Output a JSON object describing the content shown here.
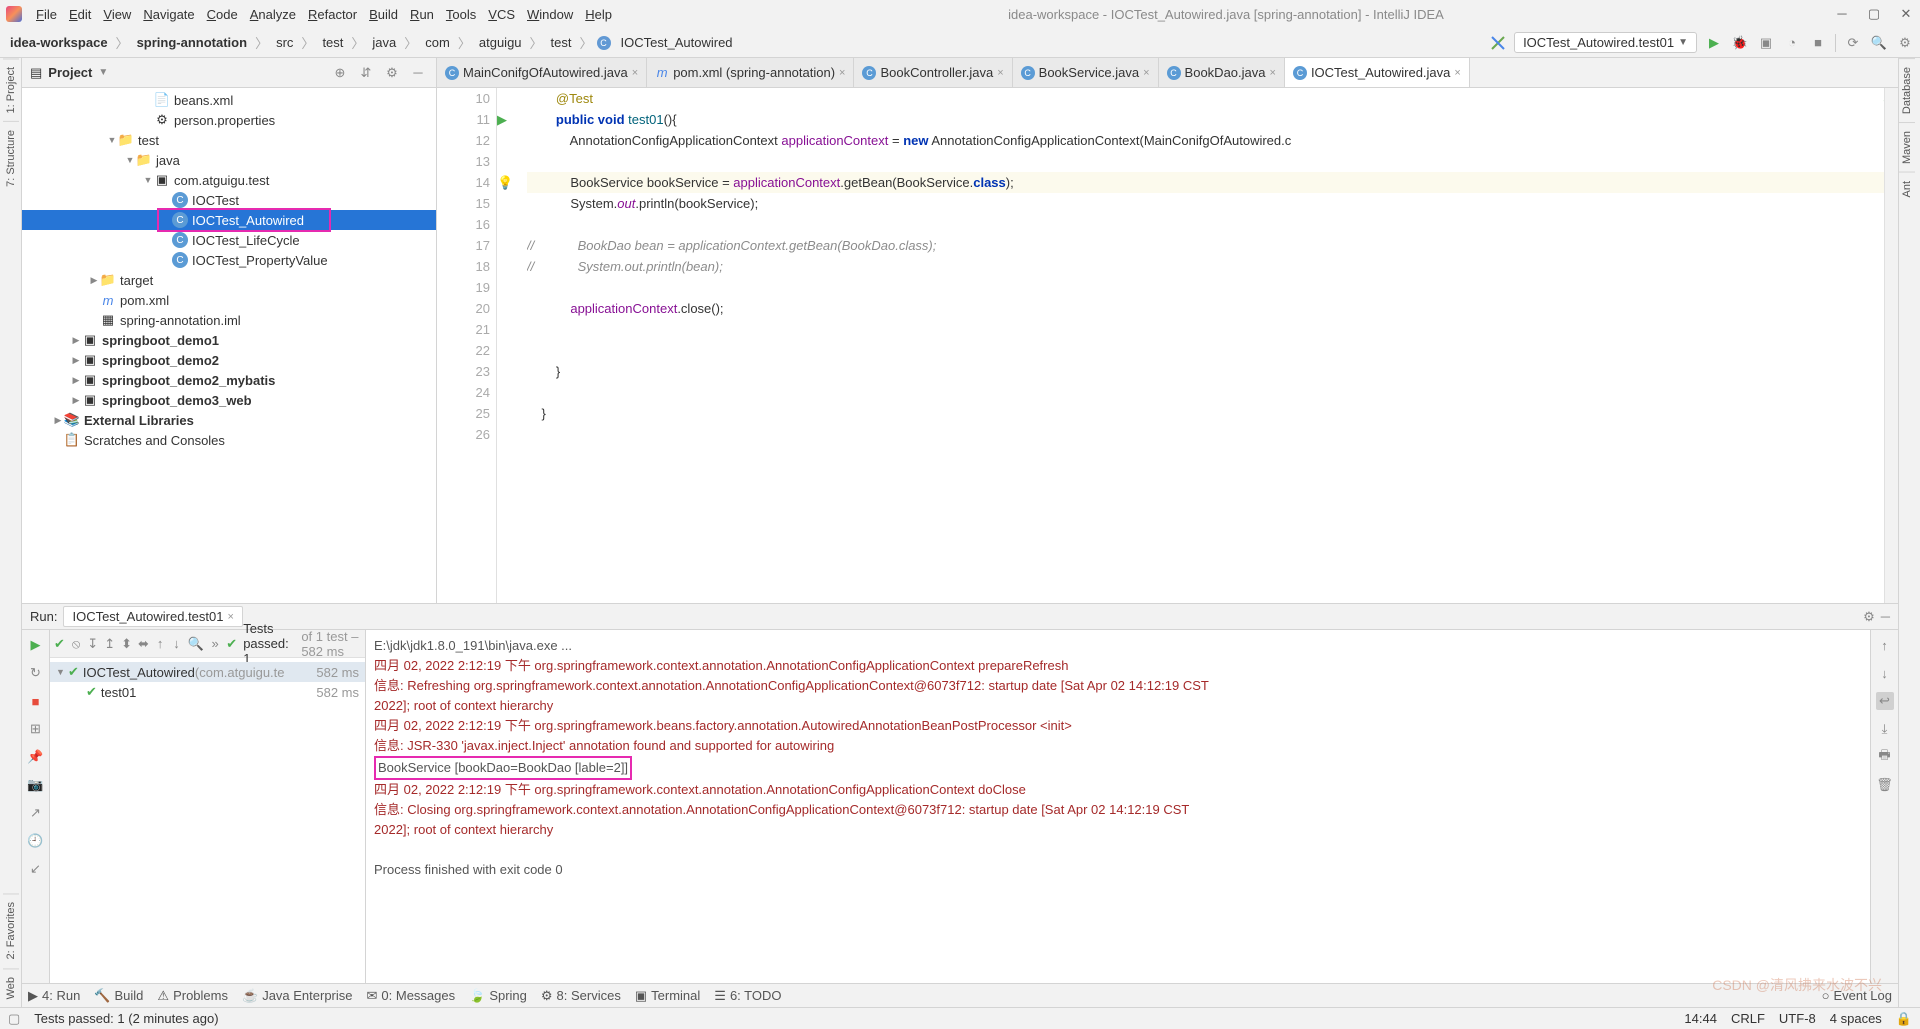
{
  "window": {
    "title": "idea-workspace - IOCTest_Autowired.java [spring-annotation] - IntelliJ IDEA"
  },
  "menu": [
    "File",
    "Edit",
    "View",
    "Navigate",
    "Code",
    "Analyze",
    "Refactor",
    "Build",
    "Run",
    "Tools",
    "VCS",
    "Window",
    "Help"
  ],
  "breadcrumb": [
    "idea-workspace",
    "spring-annotation",
    "src",
    "test",
    "java",
    "com",
    "atguigu",
    "test",
    "IOCTest_Autowired"
  ],
  "runConfig": "IOCTest_Autowired.test01",
  "leftTabs": [
    "1: Project",
    "7: Structure",
    "2: Favorites",
    "Web"
  ],
  "rightTabs": [
    "Database",
    "Maven",
    "Ant"
  ],
  "projectPanel": {
    "title": "Project",
    "tree": [
      {
        "depth": 5,
        "icon": "xml",
        "label": "beans.xml"
      },
      {
        "depth": 5,
        "icon": "prop",
        "label": "person.properties"
      },
      {
        "depth": 3,
        "exp": "▼",
        "icon": "folder",
        "label": "test"
      },
      {
        "depth": 4,
        "exp": "▼",
        "icon": "folder",
        "label": "java"
      },
      {
        "depth": 5,
        "exp": "▼",
        "icon": "pkg",
        "label": "com.atguigu.test"
      },
      {
        "depth": 6,
        "icon": "cls",
        "label": "IOCTest"
      },
      {
        "depth": 6,
        "icon": "cls",
        "label": "IOCTest_Autowired",
        "selected": true,
        "redbox": true
      },
      {
        "depth": 6,
        "icon": "cls",
        "label": "IOCTest_LifeCycle"
      },
      {
        "depth": 6,
        "icon": "cls",
        "label": "IOCTest_PropertyValue"
      },
      {
        "depth": 2,
        "exp": "▶",
        "icon": "folder-y",
        "label": "target"
      },
      {
        "depth": 2,
        "icon": "mvn",
        "label": "pom.xml"
      },
      {
        "depth": 2,
        "icon": "iml",
        "label": "spring-annotation.iml"
      },
      {
        "depth": 1,
        "exp": "▶",
        "icon": "mod",
        "label": "springboot_demo1"
      },
      {
        "depth": 1,
        "exp": "▶",
        "icon": "mod",
        "label": "springboot_demo2"
      },
      {
        "depth": 1,
        "exp": "▶",
        "icon": "mod",
        "label": "springboot_demo2_mybatis"
      },
      {
        "depth": 1,
        "exp": "▶",
        "icon": "mod",
        "label": "springboot_demo3_web"
      },
      {
        "depth": 0,
        "exp": "▶",
        "icon": "lib",
        "label": "External Libraries"
      },
      {
        "depth": 0,
        "icon": "scratch",
        "label": "Scratches and Consoles"
      }
    ]
  },
  "tabs": [
    {
      "icon": "cls",
      "label": "MainConifgOfAutowired.java"
    },
    {
      "icon": "mvn",
      "label": "pom.xml (spring-annotation)"
    },
    {
      "icon": "cls",
      "label": "BookController.java"
    },
    {
      "icon": "cls",
      "label": "BookService.java"
    },
    {
      "icon": "cls",
      "label": "BookDao.java"
    },
    {
      "icon": "cls",
      "label": "IOCTest_Autowired.java",
      "active": true
    }
  ],
  "editor": {
    "startLine": 10,
    "lines": [
      {
        "n": 10,
        "html": "        <span class='ann'>@Test</span>"
      },
      {
        "n": 11,
        "marker": "run",
        "html": "        <span class='kw'>public void</span> <span class='mth'>test01</span>(){"
      },
      {
        "n": 12,
        "html": "            AnnotationConfigApplicationContext <span class='fld'>applicationContext</span> = <span class='kw'>new</span> AnnotationConfigApplicationContext(MainConifgOfAutowired.c"
      },
      {
        "n": 13,
        "html": ""
      },
      {
        "n": 14,
        "marker": "bulb",
        "caret": true,
        "html": "            BookService bookService = <span class='fld'>applicationContext</span>.getBean(BookService.<span class='kw'>class</span>);"
      },
      {
        "n": 15,
        "html": "            System.<span class='fld ital'>out</span>.println(bookService);"
      },
      {
        "n": 16,
        "html": ""
      },
      {
        "n": 17,
        "html": "<span class='cmt'>//            BookDao bean = applicationContext.getBean(BookDao.class);</span>"
      },
      {
        "n": 18,
        "html": "<span class='cmt'>//            System.out.println(bean);</span>"
      },
      {
        "n": 19,
        "html": ""
      },
      {
        "n": 20,
        "html": "            <span class='fld'>applicationContext</span>.close();"
      },
      {
        "n": 21,
        "html": ""
      },
      {
        "n": 22,
        "html": ""
      },
      {
        "n": 23,
        "html": "        }"
      },
      {
        "n": 24,
        "html": ""
      },
      {
        "n": 25,
        "html": "    }"
      },
      {
        "n": 26,
        "html": ""
      }
    ]
  },
  "run": {
    "title": "Run:",
    "subtab": "IOCTest_Autowired.test01",
    "testsPassed": "Tests passed: 1",
    "testsTotal": " of 1 test – 582 ms",
    "tree": [
      {
        "depth": 0,
        "exp": "▼",
        "label": "IOCTest_Autowired",
        "dim": " (com.atguigu.te",
        "ms": "582 ms",
        "selected": true
      },
      {
        "depth": 1,
        "label": "test01",
        "ms": "582 ms"
      }
    ],
    "console": [
      {
        "cls": "",
        "text": "E:\\jdk\\jdk1.8.0_191\\bin\\java.exe ..."
      },
      {
        "cls": "err",
        "text": "四月 02, 2022 2:12:19 下午 org.springframework.context.annotation.AnnotationConfigApplicationContext prepareRefresh"
      },
      {
        "cls": "err",
        "text": "信息: Refreshing org.springframework.context.annotation.AnnotationConfigApplicationContext@6073f712: startup date [Sat Apr 02 14:12:19 CST"
      },
      {
        "cls": "err",
        "text": " 2022]; root of context hierarchy"
      },
      {
        "cls": "err",
        "text": "四月 02, 2022 2:12:19 下午 org.springframework.beans.factory.annotation.AutowiredAnnotationBeanPostProcessor <init>"
      },
      {
        "cls": "err",
        "text": "信息: JSR-330 'javax.inject.Inject' annotation found and supported for autowiring"
      },
      {
        "cls": "",
        "text": "BookService [bookDao=BookDao [lable=2]]",
        "boxed": true
      },
      {
        "cls": "err",
        "text": "四月 02, 2022 2:12:19 下午 org.springframework.context.annotation.AnnotationConfigApplicationContext doClose"
      },
      {
        "cls": "err",
        "text": "信息: Closing org.springframework.context.annotation.AnnotationConfigApplicationContext@6073f712: startup date [Sat Apr 02 14:12:19 CST"
      },
      {
        "cls": "err",
        "text": " 2022]; root of context hierarchy"
      },
      {
        "cls": "",
        "text": ""
      },
      {
        "cls": "",
        "text": "Process finished with exit code 0"
      }
    ]
  },
  "toolstrip": [
    {
      "icon": "▶",
      "label": "4: Run"
    },
    {
      "icon": "🔨",
      "label": "Build"
    },
    {
      "icon": "⚠",
      "label": "Problems"
    },
    {
      "icon": "☕",
      "label": "Java Enterprise"
    },
    {
      "icon": "✉",
      "label": "0: Messages"
    },
    {
      "icon": "🍃",
      "label": "Spring"
    },
    {
      "icon": "⚙",
      "label": "8: Services"
    },
    {
      "icon": "▣",
      "label": "Terminal"
    },
    {
      "icon": "☰",
      "label": "6: TODO"
    }
  ],
  "eventLog": "Event Log",
  "statusbar": {
    "msg": "Tests passed: 1 (2 minutes ago)",
    "time": "14:44",
    "enc": "CRLF",
    "enc2": "UTF-8",
    "spaces": "4 spaces",
    "branch": ""
  },
  "watermark": "CSDN @清风拂来水波不兴"
}
